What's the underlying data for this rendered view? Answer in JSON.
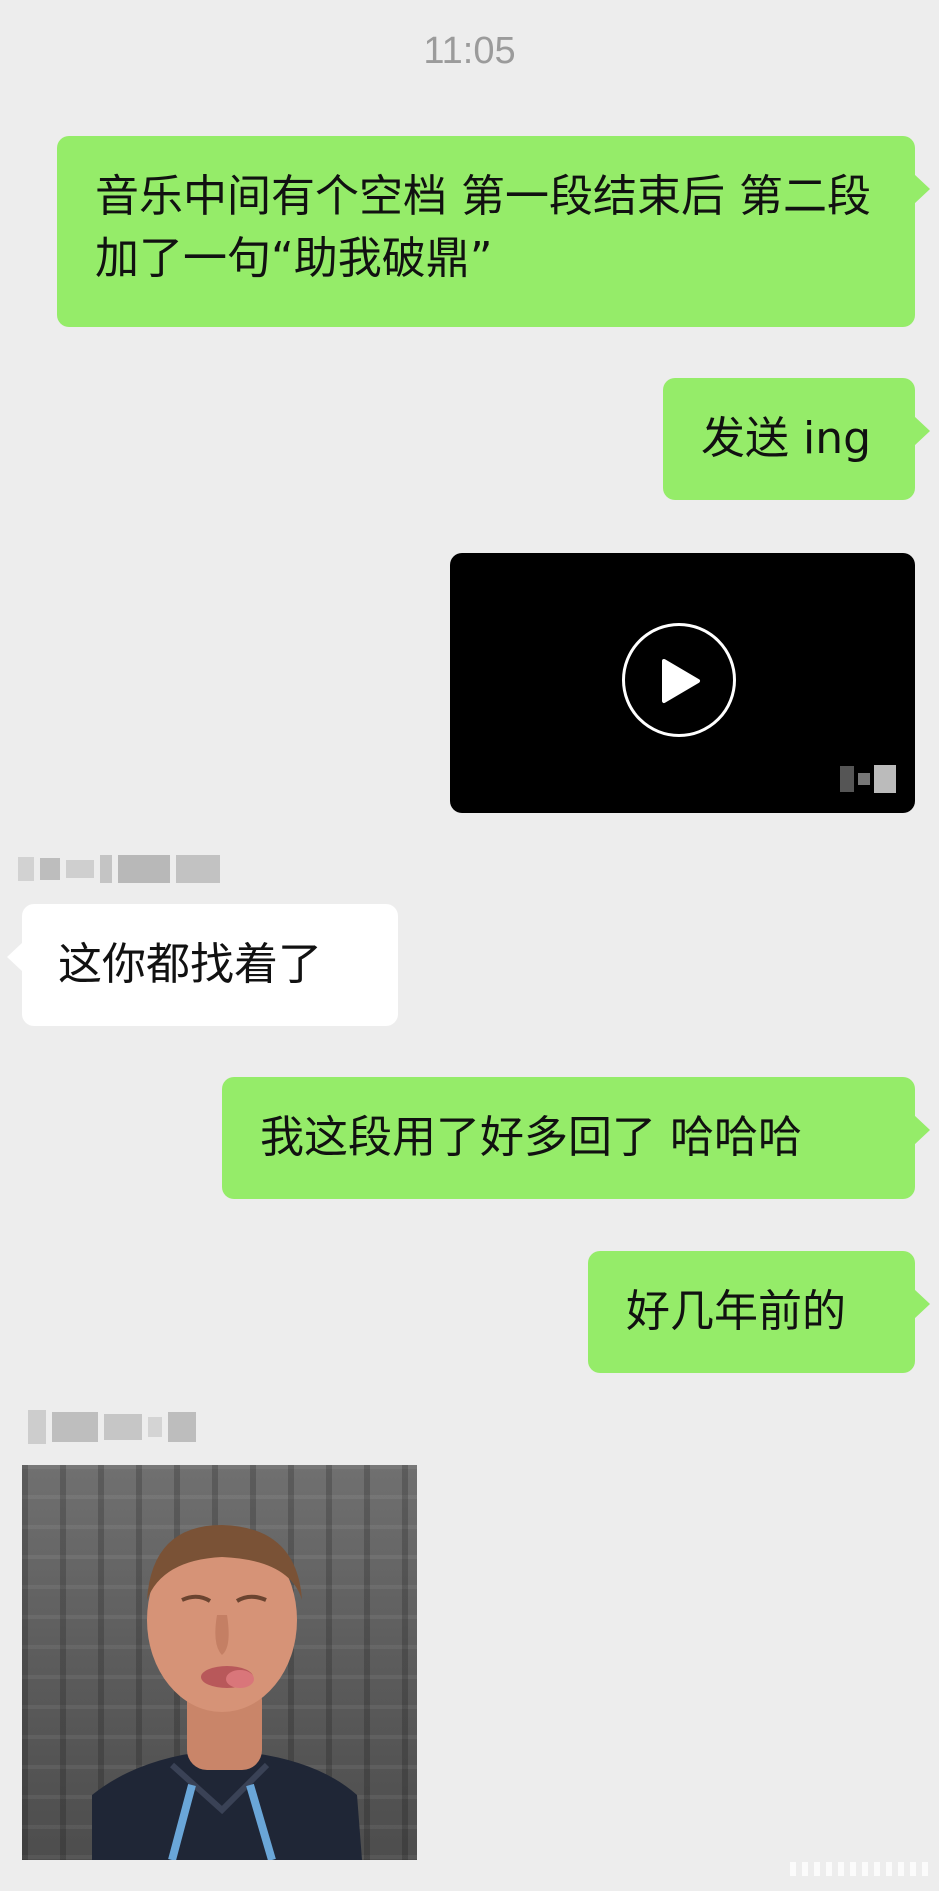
{
  "chat": {
    "timestamp": "11:05",
    "messages": [
      {
        "side": "me",
        "text": "音乐中间有个空档 第一段结束后 第二段加了一句“助我破鼎”"
      },
      {
        "side": "me",
        "text": "发送 ing"
      },
      {
        "side": "me",
        "type": "video"
      },
      {
        "side": "them",
        "text": "这你都找着了"
      },
      {
        "side": "me",
        "text": "我这段用了好多回了 哈哈哈"
      },
      {
        "side": "me",
        "text": "好几年前的"
      },
      {
        "side": "them",
        "type": "sticker",
        "icon": "man-tongue-out-sticker"
      }
    ]
  },
  "colors": {
    "background": "#ededed",
    "sent_bubble": "#95ec69",
    "received_bubble": "#ffffff"
  }
}
